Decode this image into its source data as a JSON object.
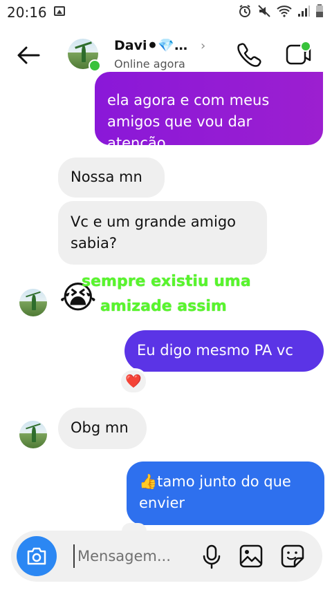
{
  "status_bar": {
    "time": "20:16"
  },
  "header": {
    "contact_name": "Davi⚫💎…",
    "contact_status": "Online agora",
    "chevron": "›"
  },
  "messages": [
    {
      "side": "out",
      "text": "ela agora e com meus amigos que vou dar atenção"
    },
    {
      "side": "in",
      "text": "Nossa mn"
    },
    {
      "side": "in",
      "text": "Vc e um grande amigo sabia?"
    },
    {
      "side": "out",
      "text": "Eu digo mesmo PA vc"
    },
    {
      "side": "in",
      "text": "Obg mn"
    },
    {
      "side": "out",
      "text": "👍tamo junto do que envier"
    }
  ],
  "story_reply": {
    "emoji": "😭",
    "line1": "sempre existiu uma",
    "line2": "amizade assim"
  },
  "reaction": {
    "emoji": "❤️"
  },
  "composer": {
    "placeholder": "Mensagem..."
  },
  "colors": {
    "outgoing_purple": "#8a18d8",
    "outgoing_indigo": "#5b34e6",
    "outgoing_blue": "#2e70ee",
    "incoming_bg": "#efefef",
    "online": "#38c23b",
    "camera_button": "#2b87f3",
    "caption_green": "#58f52d"
  }
}
